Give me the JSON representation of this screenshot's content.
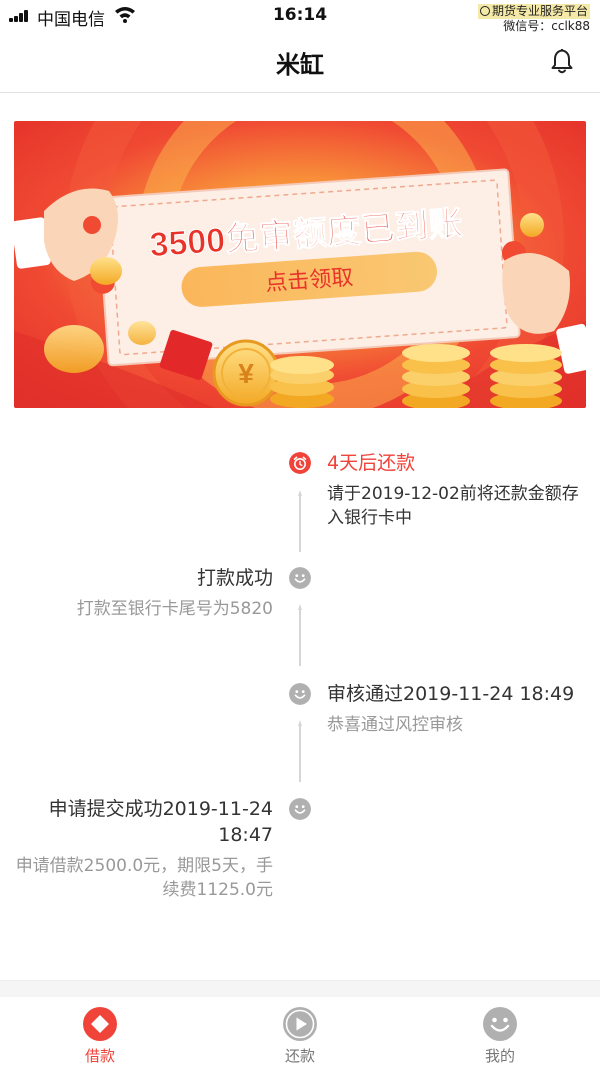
{
  "status_bar": {
    "carrier": "中国电信",
    "time": "16:14",
    "watermark_line1": "期货专业服务平台",
    "watermark_line2": "微信号：cclk88"
  },
  "nav": {
    "title": "米缸"
  },
  "banner": {
    "headline": "3500免审额度已到账",
    "button_label": "点击领取",
    "coin_symbol": "¥"
  },
  "timeline": {
    "items": [
      {
        "title": "4天后还款",
        "desc": "请于2019-12-02前将还款金额存入银行卡中",
        "side": "right",
        "status": "current"
      },
      {
        "title": "打款成功",
        "desc": "打款至银行卡尾号为5820",
        "side": "left",
        "status": "done"
      },
      {
        "title": "审核通过2019-11-24 18:49",
        "desc": "恭喜通过风控审核",
        "side": "right",
        "status": "done"
      },
      {
        "title": "申请提交成功2019-11-24 18:47",
        "desc": "申请借款2500.0元，期限5天，手续费1125.0元",
        "side": "left",
        "status": "done"
      }
    ]
  },
  "tabbar": {
    "tabs": [
      {
        "label": "借款",
        "icon": "diamond-icon",
        "active": true
      },
      {
        "label": "还款",
        "icon": "play-icon",
        "active": false
      },
      {
        "label": "我的",
        "icon": "smiley-icon",
        "active": false
      }
    ]
  },
  "colors": {
    "accent": "#f0433a",
    "muted_text": "#999999",
    "icon_gray": "#b0b0b0",
    "banner_red": "#ec3b2c",
    "banner_orange": "#f9a23a"
  }
}
